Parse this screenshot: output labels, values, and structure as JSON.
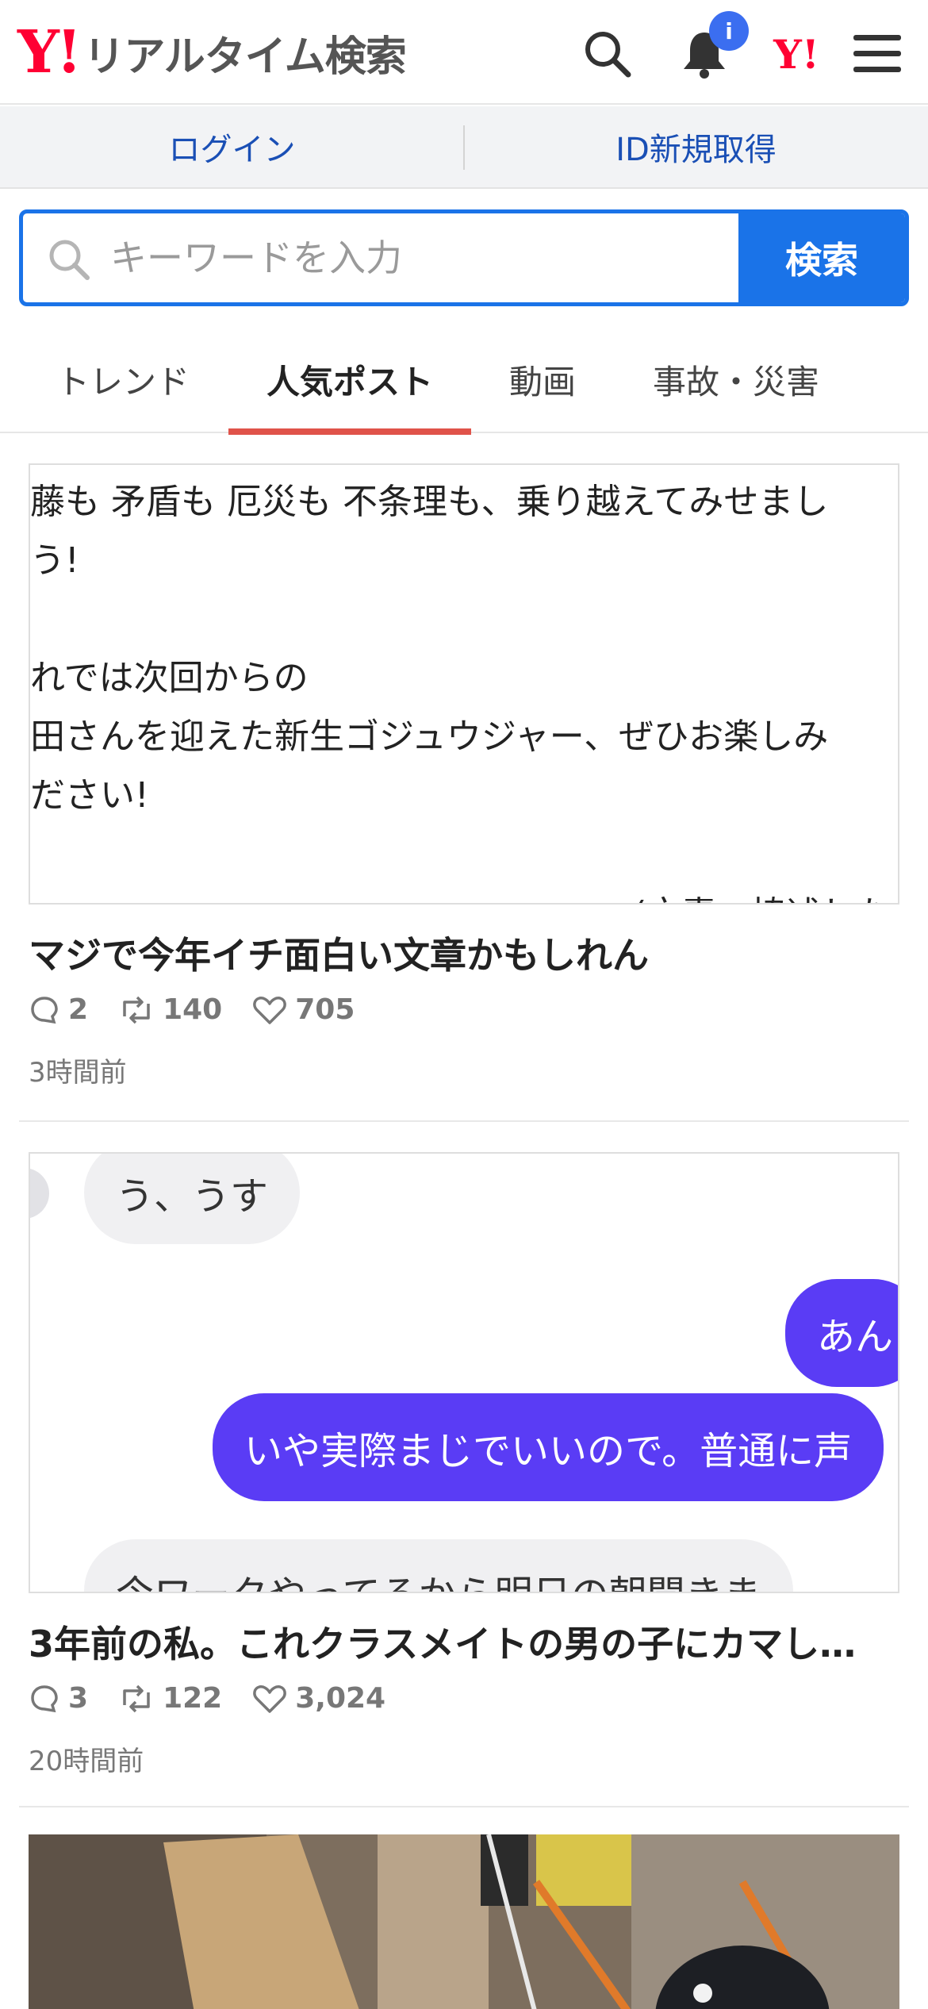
{
  "header": {
    "logo_mark": "Y!",
    "logo_text": "リアルタイム検索",
    "notification_badge": "i",
    "yahoo_mark": "Y!"
  },
  "login_bar": {
    "login": "ログイン",
    "register": "ID新規取得"
  },
  "search": {
    "placeholder": "キーワードを入力",
    "button": "検索"
  },
  "tabs": [
    {
      "label": "トレンド",
      "active": false
    },
    {
      "label": "人気ポスト",
      "active": true
    },
    {
      "label": "動画",
      "active": false
    },
    {
      "label": "事故・災害",
      "active": false
    }
  ],
  "posts": [
    {
      "image_text": [
        "藤も 矛盾も 厄災も 不条理も、乗り越えてみせまし",
        "う!",
        "",
        "れでは次回からの",
        "田さんを迎えた新生ゴジュウジャー、ぜひお楽しみ",
        "ださい!",
        "",
        "(文責：協述した"
      ],
      "title": "マジで今年イチ面白い文章かもしれん",
      "replies": "2",
      "reposts": "140",
      "likes": "705",
      "time": "3時間前"
    },
    {
      "chat": [
        {
          "text": "う、うす",
          "side": "left"
        },
        {
          "text": "あん",
          "side": "right"
        },
        {
          "text": "いや実際まじでいいので。普通に声",
          "side": "right"
        },
        {
          "text": "今ワークやってるから明日の朝聞きま",
          "side": "left"
        }
      ],
      "title": "3年前の私。これクラスメイトの男の子にカマし…",
      "replies": "3",
      "reposts": "122",
      "likes": "3,024",
      "time": "20時間前"
    }
  ],
  "colors": {
    "brand_red": "#ff0033",
    "link_blue": "#1a4fb5",
    "search_blue": "#1a73e8",
    "tab_underline": "#e0534a",
    "chat_purple": "#5a3cf5"
  },
  "icons": [
    "search-icon",
    "bell-icon",
    "menu-icon",
    "reply-icon",
    "repost-icon",
    "heart-icon"
  ]
}
